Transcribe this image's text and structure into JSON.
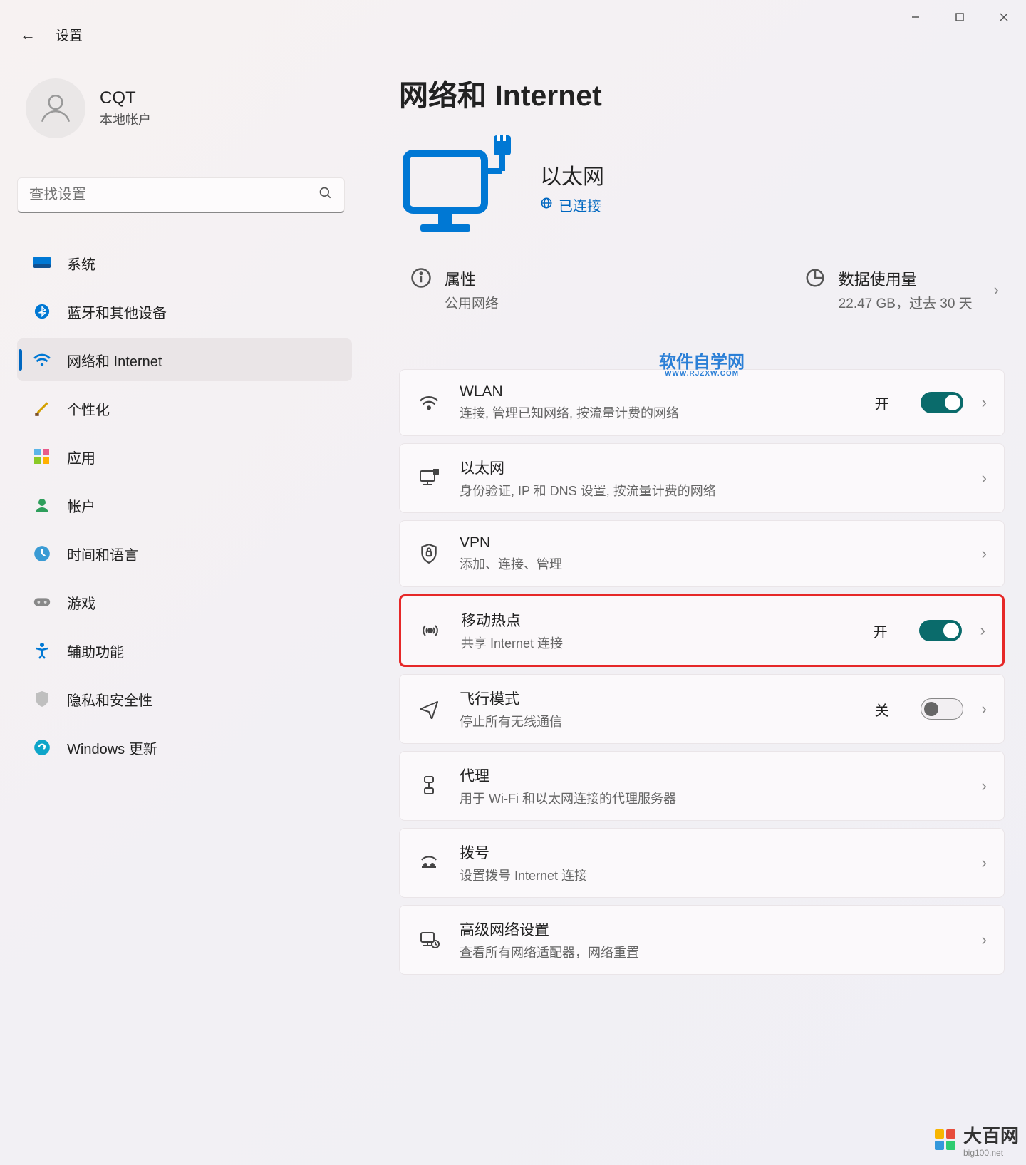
{
  "window": {
    "back_icon": "←",
    "app_title": "设置"
  },
  "user": {
    "name": "CQT",
    "account_type": "本地帐户"
  },
  "search": {
    "placeholder": "查找设置"
  },
  "nav": {
    "items": [
      {
        "label": "系统",
        "icon": "system"
      },
      {
        "label": "蓝牙和其他设备",
        "icon": "bluetooth"
      },
      {
        "label": "网络和 Internet",
        "icon": "wifi",
        "active": true
      },
      {
        "label": "个性化",
        "icon": "brush"
      },
      {
        "label": "应用",
        "icon": "apps"
      },
      {
        "label": "帐户",
        "icon": "account"
      },
      {
        "label": "时间和语言",
        "icon": "time"
      },
      {
        "label": "游戏",
        "icon": "game"
      },
      {
        "label": "辅助功能",
        "icon": "accessibility"
      },
      {
        "label": "隐私和安全性",
        "icon": "privacy"
      },
      {
        "label": "Windows 更新",
        "icon": "update"
      }
    ]
  },
  "page": {
    "title": "网络和 Internet",
    "status": {
      "name": "以太网",
      "state": "已连接"
    },
    "properties": {
      "title": "属性",
      "sub": "公用网络"
    },
    "usage": {
      "title": "数据使用量",
      "sub": "22.47 GB，过去 30 天"
    },
    "watermark": {
      "main": "软件自学网",
      "sub": "WWW.RJZXW.COM"
    },
    "cards": [
      {
        "title": "WLAN",
        "sub": "连接, 管理已知网络, 按流量计费的网络",
        "state_label": "开",
        "toggle": "on"
      },
      {
        "title": "以太网",
        "sub": "身份验证, IP 和 DNS 设置, 按流量计费的网络"
      },
      {
        "title": "VPN",
        "sub": "添加、连接、管理"
      },
      {
        "title": "移动热点",
        "sub": "共享 Internet 连接",
        "state_label": "开",
        "toggle": "on",
        "highlight": true
      },
      {
        "title": "飞行模式",
        "sub": "停止所有无线通信",
        "state_label": "关",
        "toggle": "off"
      },
      {
        "title": "代理",
        "sub": "用于 Wi-Fi 和以太网连接的代理服务器"
      },
      {
        "title": "拨号",
        "sub": "设置拨号 Internet 连接"
      },
      {
        "title": "高级网络设置",
        "sub": "查看所有网络适配器，网络重置"
      }
    ]
  },
  "footer": {
    "brand": "大百网",
    "url": "big100.net"
  }
}
